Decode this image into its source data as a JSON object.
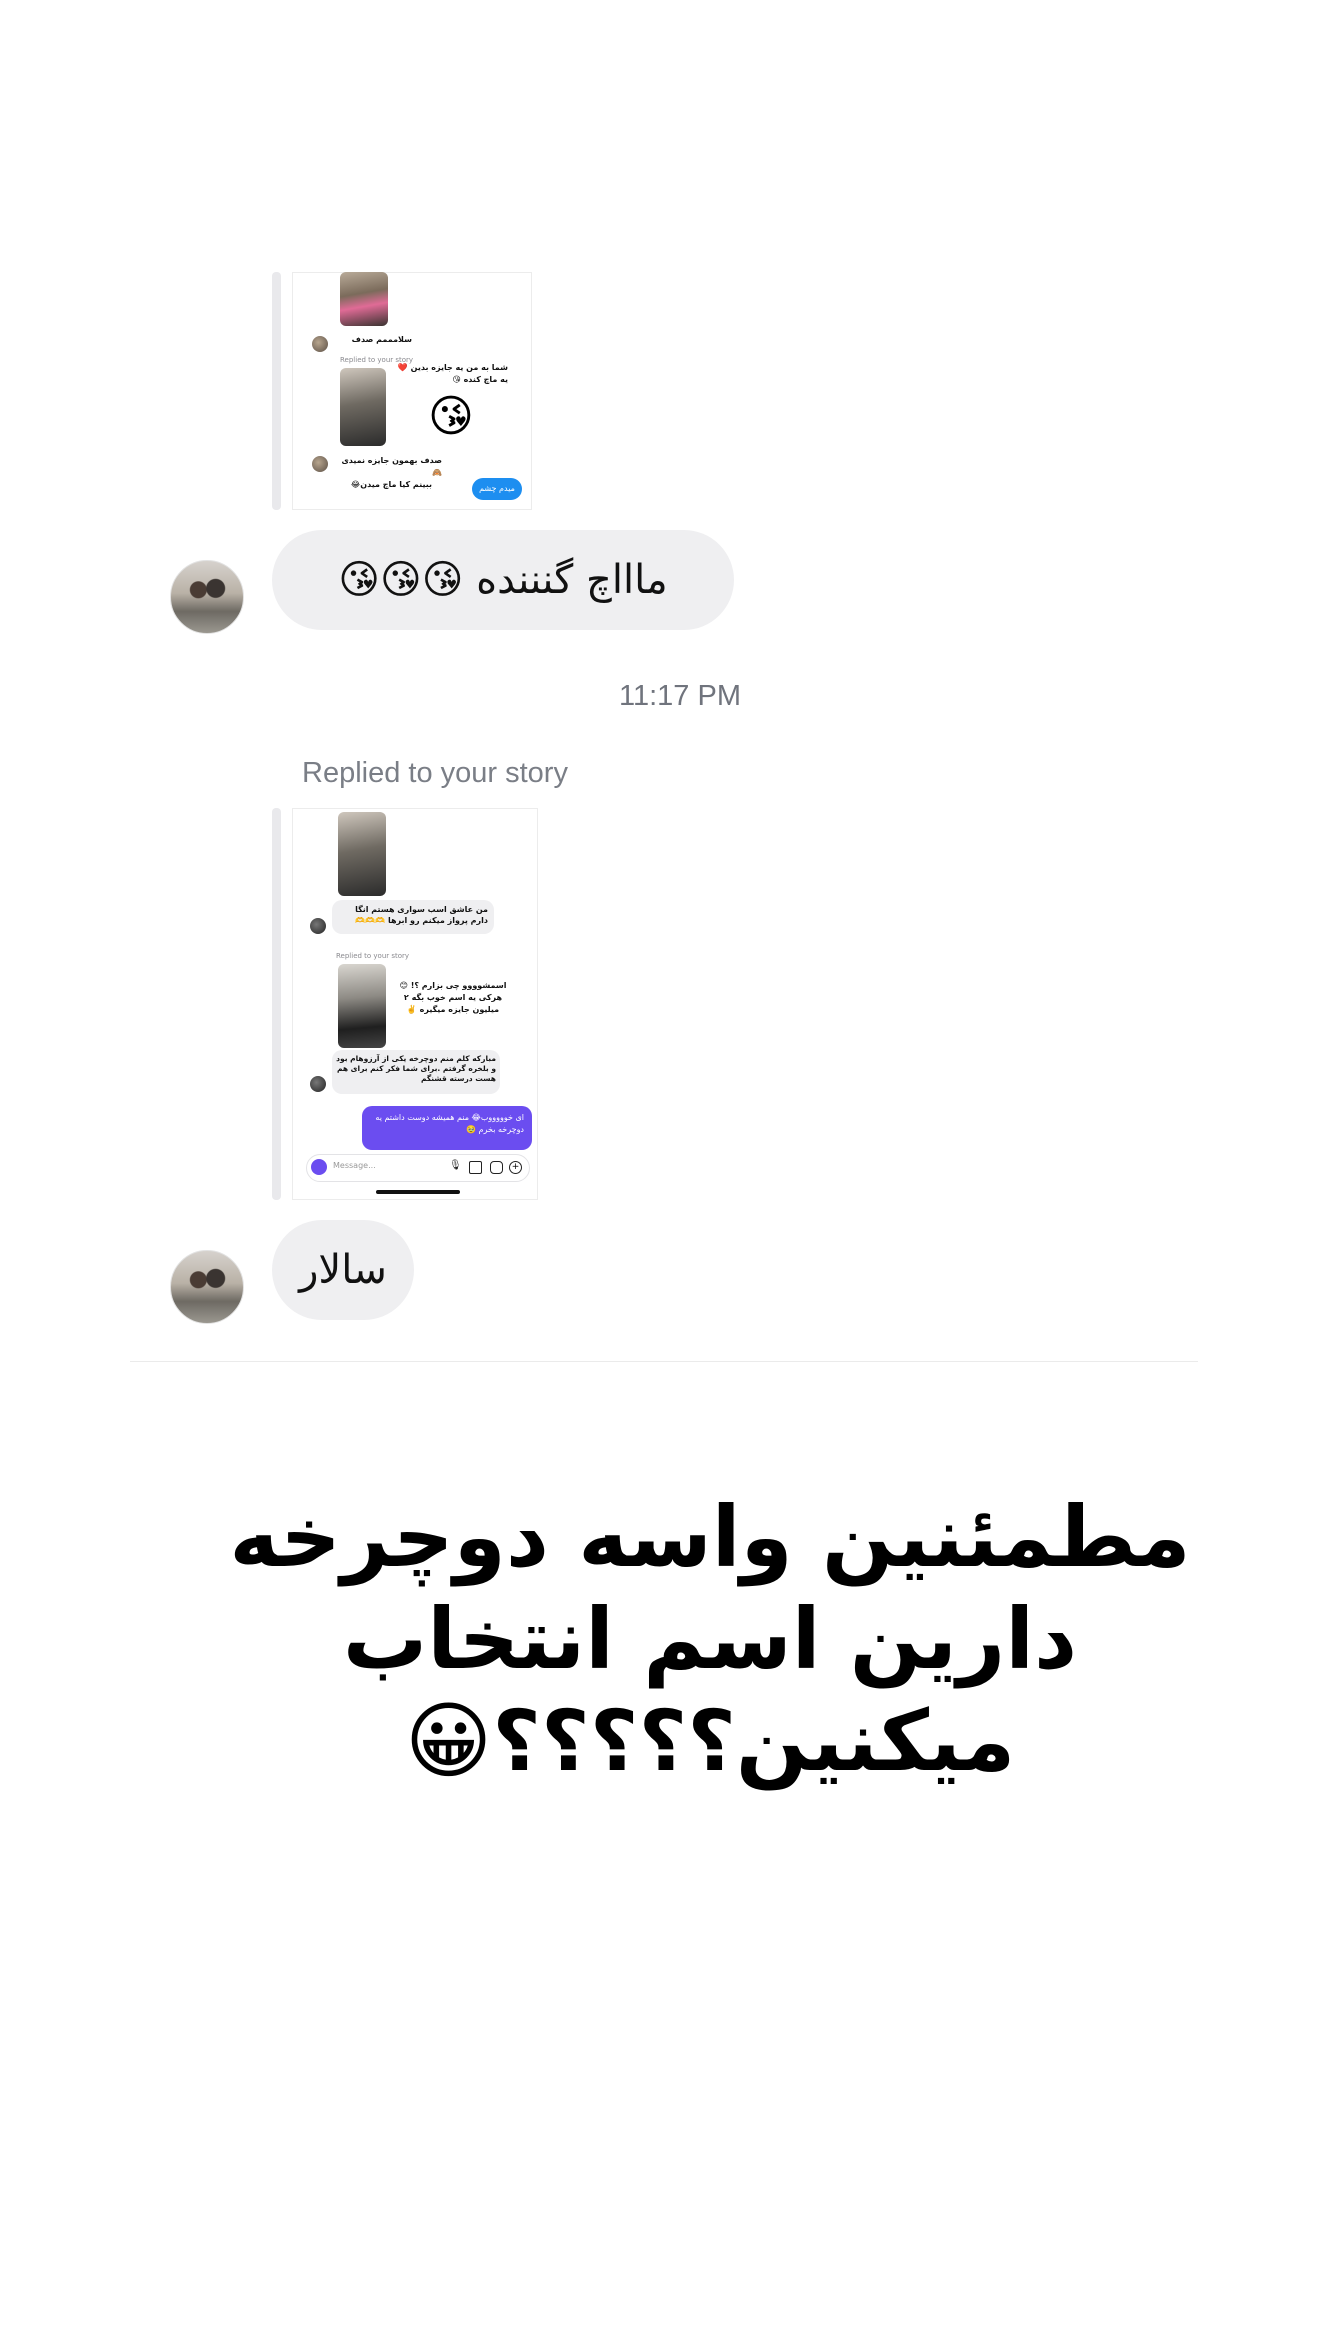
{
  "story_reply_top": {
    "mini_greeting": "سلامممم صدف",
    "mini_replied_label": "Replied to your story",
    "mini_question": "شما به من یه جایزه بدین ❤️ یه ماچ کنده 😘",
    "mini_emoji": "😘",
    "mini_answer": "صدف بهمون جایزه نمیدی 🙈",
    "mini_footer": "ببینم کیا ماچ میدن😂",
    "mini_button": "میدم چشم"
  },
  "message_1": {
    "text": "ماااچ گنننده 😘😘😘"
  },
  "timestamp": "11:17 PM",
  "story_reply_bottom": {
    "label": "Replied to your story",
    "mini_msg1": "من عاشق اسب سواری هستم انگا دارم پرواز میکنم رو ابرها 🫶🫶🫶",
    "mini_replied_label": "Replied to your story",
    "mini_question": "اسمشوووو چی بزارم ؟! 😊 هرکی یه اسم خوب بگه ۲ میلیون جایزه میگیره ✌️",
    "mini_msg2": "مبارکه کلم منم دوچرخه یکی از آرزوهام بود و بلخره گرفتم .برای شما فکر کنم برای هم هست درسته قشنگم",
    "mini_purple": "ای خوووووب😂 منم همیشه دوست داشتم یه دوچرخه بخرم 🥹",
    "mini_input_placeholder": "Message..."
  },
  "message_2": {
    "text": "سالار"
  },
  "caption": {
    "line1": "مطمئنین  واسه دوچرخه",
    "line2": "دارین اسم انتخاب",
    "line3": "میکنین؟؟؟؟؟😀"
  },
  "colors": {
    "bubble_bg": "#efeff1",
    "timestamp": "#70747d",
    "story_button": "#1d8ef0",
    "purple_bubble": "#6b4df0"
  }
}
